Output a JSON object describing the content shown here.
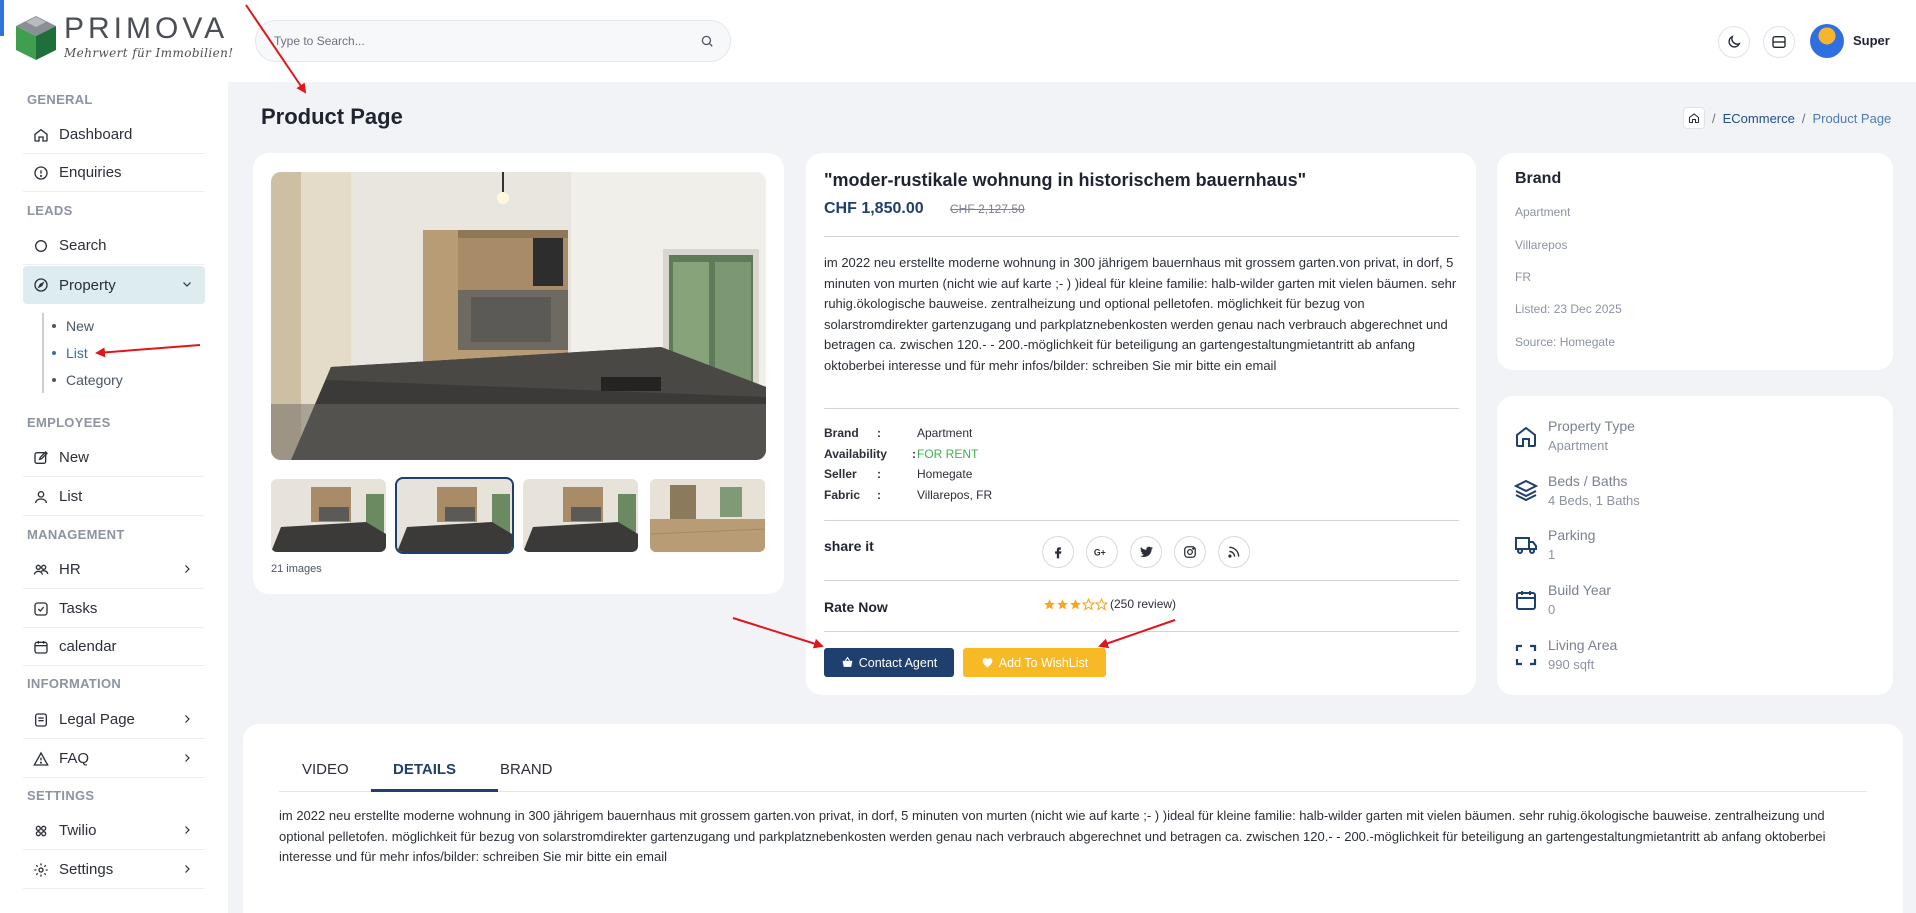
{
  "logo": {
    "name": "PRIMOVA",
    "tagline": "Mehrwert für Immobilien!"
  },
  "search": {
    "placeholder": "Type to Search..."
  },
  "user": {
    "name": "Super"
  },
  "sidebar": {
    "sections": {
      "general": "GENERAL",
      "leads": "LEADS",
      "employees": "EMPLOYEES",
      "management": "MANAGEMENT",
      "information": "INFORMATION",
      "settings": "SETTINGS"
    },
    "items": {
      "dashboard": "Dashboard",
      "enquiries": "Enquiries",
      "search": "Search",
      "property": "Property",
      "property_new": "New",
      "property_list": "List",
      "property_category": "Category",
      "employees_new": "New",
      "employees_list": "List",
      "hr": "HR",
      "tasks": "Tasks",
      "calendar": "calendar",
      "legal_page": "Legal Page",
      "faq": "FAQ",
      "twilio": "Twilio",
      "settings": "Settings"
    }
  },
  "page": {
    "title": "Product Page"
  },
  "breadcrumb": {
    "link": "ECommerce",
    "current": "Product Page",
    "sep": "/"
  },
  "gallery": {
    "image_count": "21 images"
  },
  "product": {
    "title": "\"moder-rustikale wohnung in historischem bauernhaus\"",
    "price": "CHF 1,850.00",
    "old_price": "CHF 2,127.50",
    "description": "im 2022 neu erstellte moderne wohnung in 300 jährigem bauernhaus mit grossem garten.von privat, in dorf, 5 minuten von murten (nicht wie auf karte ;- ) )ideal für kleine familie: halb-wilder garten mit vielen bäumen. sehr ruhig.ökologische bauweise. zentralheizung und optional pelletofen. möglichkeit für bezug von solarstromdirekter gartenzugang und parkplatznebenkosten werden genau nach verbrauch abgerechnet und betragen ca. zwischen 120.- - 200.-möglichkeit für beteiligung an gartengestaltungmietantritt ab anfang oktoberbei interesse und für mehr infos/bilder: schreiben Sie mir bitte ein email",
    "specs": {
      "colon": ":",
      "brand_label": "Brand",
      "brand_value": "Apartment",
      "availability_label": "Availability",
      "availability_value": "FOR RENT",
      "seller_label": "Seller",
      "seller_value": "Homegate",
      "fabric_label": "Fabric",
      "fabric_value": "Villarepos, FR"
    },
    "share_label": "share it",
    "rate_label": "Rate Now",
    "rating": 3,
    "rating_max": 5,
    "review_text": "(250 review)",
    "contact_button": "Contact Agent",
    "wishlist_button": "Add To WishList"
  },
  "brand_card": {
    "title": "Brand",
    "type": "Apartment",
    "city": "Villarepos",
    "country": "FR",
    "listed": "Listed: 23 Dec 2025",
    "source": "Source: Homegate"
  },
  "features": [
    {
      "label": "Property Type",
      "value": "Apartment",
      "icon": "home-icon"
    },
    {
      "label": "Beds / Baths",
      "value": "4 Beds, 1 Baths",
      "icon": "layers-icon"
    },
    {
      "label": "Parking",
      "value": "1",
      "icon": "truck-icon"
    },
    {
      "label": "Build Year",
      "value": "0",
      "icon": "calendar-icon"
    },
    {
      "label": "Living Area",
      "value": "990 sqft",
      "icon": "expand-icon"
    }
  ],
  "tabs": {
    "video": "VIDEO",
    "details": "DETAILS",
    "brand": "BRAND",
    "active": "DETAILS"
  },
  "details_text": "im 2022 neu erstellte moderne wohnung in 300 jährigem bauernhaus mit grossem garten.von privat, in dorf, 5 minuten von murten (nicht wie auf karte ;- ) )ideal für kleine familie: halb-wilder garten mit vielen bäumen. sehr ruhig.ökologische bauweise. zentralheizung und optional pelletofen. möglichkeit für bezug von solarstromdirekter gartenzugang und parkplatznebenkosten werden genau nach verbrauch abgerechnet und betragen ca. zwischen 120.- - 200.-möglichkeit für beteiligung an gartengestaltungmietantritt ab anfang oktoberbei interesse und für mehr infos/bilder: schreiben Sie mir bitte ein email",
  "colors": {
    "primary": "#1f3f6e",
    "warning": "#f7b924",
    "success": "#3fb24f",
    "annotation": "#e0161b",
    "active_nav": "#dcecef"
  }
}
